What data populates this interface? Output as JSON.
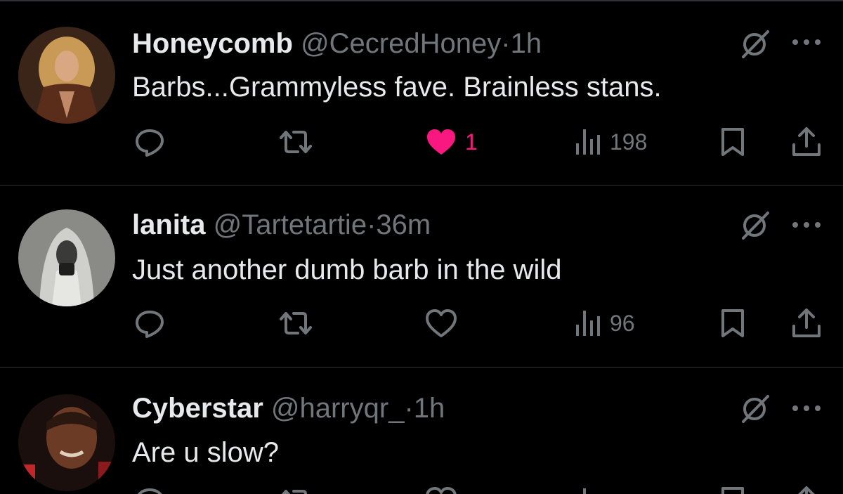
{
  "tweets": [
    {
      "name": "Honeycomb",
      "handle": "@CecredHoney",
      "separator": "·",
      "time": "1h",
      "text": "Barbs...Grammyless fave. Brainless stans.",
      "likes": "1",
      "liked": true,
      "views": "198",
      "avatar_colors": {
        "bg": "#3b2418",
        "hair": "#c99a55",
        "face": "#d9a882",
        "coat": "#5a2c1a"
      }
    },
    {
      "name": "lanita",
      "handle": "@Tartetartie",
      "separator": "·",
      "time": "36m",
      "text": "Just another dumb barb in the wild",
      "likes": "",
      "liked": false,
      "views": "96",
      "avatar_colors": {
        "bg": "#8a8a86",
        "veil": "#cfcfcb",
        "face": "#3a3a38",
        "dark": "#1e1e1d"
      }
    },
    {
      "name": "Cyberstar",
      "handle": "@harryqr_",
      "separator": "·",
      "time": "1h",
      "text": "Are u slow?",
      "likes": "",
      "liked": false,
      "views": "",
      "avatar_colors": {
        "bg": "#1a0f0c",
        "face": "#6b3b26",
        "accent": "#c0262a"
      }
    }
  ],
  "colors": {
    "like_pink": "#f91880",
    "icon_gray": "#71767b",
    "text": "#e7e9ea",
    "divider": "#2f3336"
  },
  "icons": [
    "grok-icon",
    "more-icon",
    "reply-icon",
    "retweet-icon",
    "like-icon",
    "views-icon",
    "bookmark-icon",
    "share-icon"
  ]
}
